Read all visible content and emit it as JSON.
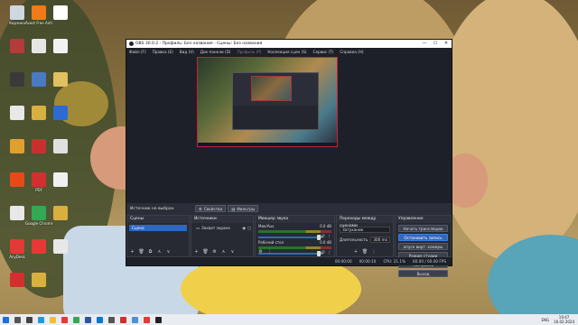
{
  "desktop": {
    "icons": [
      {
        "label": "Корзина",
        "color": "#cfd8e0"
      },
      {
        "label": "Avast Free Antivirus",
        "color": "#f07a1a"
      },
      {
        "label": "",
        "color": "#ffffff"
      },
      {
        "label": "",
        "color": "#b53a3a"
      },
      {
        "label": "",
        "color": "#e6e6e6"
      },
      {
        "label": "",
        "color": "#f2f2f2"
      },
      {
        "label": "",
        "color": "#3a3a3a"
      },
      {
        "label": "",
        "color": "#4a7ac4"
      },
      {
        "label": "",
        "color": "#e0c060"
      },
      {
        "label": "",
        "color": "#e8e8e8"
      },
      {
        "label": "",
        "color": "#d8b040"
      },
      {
        "label": "",
        "color": "#2a6bd4"
      },
      {
        "label": "",
        "color": "#e0a030"
      },
      {
        "label": "",
        "color": "#c83030"
      },
      {
        "label": "",
        "color": "#e0e0e0"
      },
      {
        "label": "",
        "color": "#e64a19"
      },
      {
        "label": "PDF",
        "color": "#d03030"
      },
      {
        "label": "",
        "color": "#f0f0f0"
      },
      {
        "label": "",
        "color": "#e8e8e8"
      },
      {
        "label": "Google Chrome",
        "color": "#34a853"
      },
      {
        "label": "",
        "color": "#d8b040"
      },
      {
        "label": "AnyDesk",
        "color": "#e53935"
      },
      {
        "label": "",
        "color": "#e53935"
      },
      {
        "label": "",
        "color": "#e8e8e8"
      },
      {
        "label": "",
        "color": "#d32f2f"
      },
      {
        "label": "",
        "color": "#d8b040"
      }
    ]
  },
  "obs": {
    "title": "OBS 30.0.2 - Профиль: Без названия - Сцены: Без названия",
    "window_buttons": [
      "—",
      "☐",
      "✕"
    ],
    "menu": [
      {
        "label": "Файл (F)",
        "dim": false
      },
      {
        "label": "Правка (E)",
        "dim": false
      },
      {
        "label": "Вид (V)",
        "dim": false
      },
      {
        "label": "Док-панели (D)",
        "dim": false
      },
      {
        "label": "Профиль (P)",
        "dim": true
      },
      {
        "label": "Коллекция сцен (S)",
        "dim": false
      },
      {
        "label": "Сервис (T)",
        "dim": false
      },
      {
        "label": "Справка (H)",
        "dim": false
      }
    ],
    "source_bar": {
      "no_selection": "Источник не выбран",
      "properties": "Свойства",
      "filters": "Фильтры"
    },
    "scenes": {
      "header": "Сцены",
      "items": [
        "Сцена"
      ],
      "footer": [
        "+",
        "🗑",
        "⧉",
        "∧",
        "∨"
      ]
    },
    "sources": {
      "header": "Источники",
      "items": [
        "Захват экрана"
      ],
      "footer": [
        "+",
        "🗑",
        "⚙",
        "∧",
        "∨"
      ]
    },
    "mixer": {
      "header": "Микшер звука",
      "channels": [
        {
          "name": "Мик/Aux",
          "db": "0.0 dB",
          "level": 0.0
        },
        {
          "name": "Рабочий стол",
          "db": "0.0 dB",
          "level": 0.0
        }
      ],
      "footer": [
        "⚙",
        "⋮"
      ]
    },
    "transitions": {
      "header": "Переходы между сценами",
      "type_label": "Затухание",
      "duration_label": "Длительность",
      "duration_value": "300 ms",
      "footer": [
        "+",
        "🗑",
        "⋮"
      ]
    },
    "controls": {
      "header": "Управление",
      "buttons": [
        {
          "label": "Начать трансляцию",
          "active": false
        },
        {
          "label": "Остановить запись",
          "active": true
        },
        {
          "label": "апуск вирт. камеры",
          "active": false
        },
        {
          "label": "Режим студии",
          "active": false
        },
        {
          "label": "Настройки",
          "active": false
        },
        {
          "label": "Выход",
          "active": false
        }
      ]
    },
    "status": {
      "rec_time": "00:00:10",
      "stream_time": "00:00:00",
      "cpu": "CPU: 21.1%",
      "fps": "60.00 / 60.00 FPS"
    }
  },
  "taskbar": {
    "lang": "ENG",
    "time": "19:47",
    "date": "16.02.2024",
    "apps": [
      {
        "name": "start",
        "color": "#1e6fd9"
      },
      {
        "name": "search",
        "color": "#555555"
      },
      {
        "name": "task-view",
        "color": "#444444"
      },
      {
        "name": "edge",
        "color": "#1b9de2"
      },
      {
        "name": "explorer",
        "color": "#f2c12e"
      },
      {
        "name": "yandex",
        "color": "#e53935"
      },
      {
        "name": "chrome",
        "color": "#34a853"
      },
      {
        "name": "word",
        "color": "#2b579a"
      },
      {
        "name": "mail",
        "color": "#0078d4"
      },
      {
        "name": "store",
        "color": "#555555"
      },
      {
        "name": "pdf",
        "color": "#d03030"
      },
      {
        "name": "photos",
        "color": "#4f8fd4"
      },
      {
        "name": "anydesk",
        "color": "#e53935"
      },
      {
        "name": "obs",
        "color": "#222222"
      }
    ]
  }
}
